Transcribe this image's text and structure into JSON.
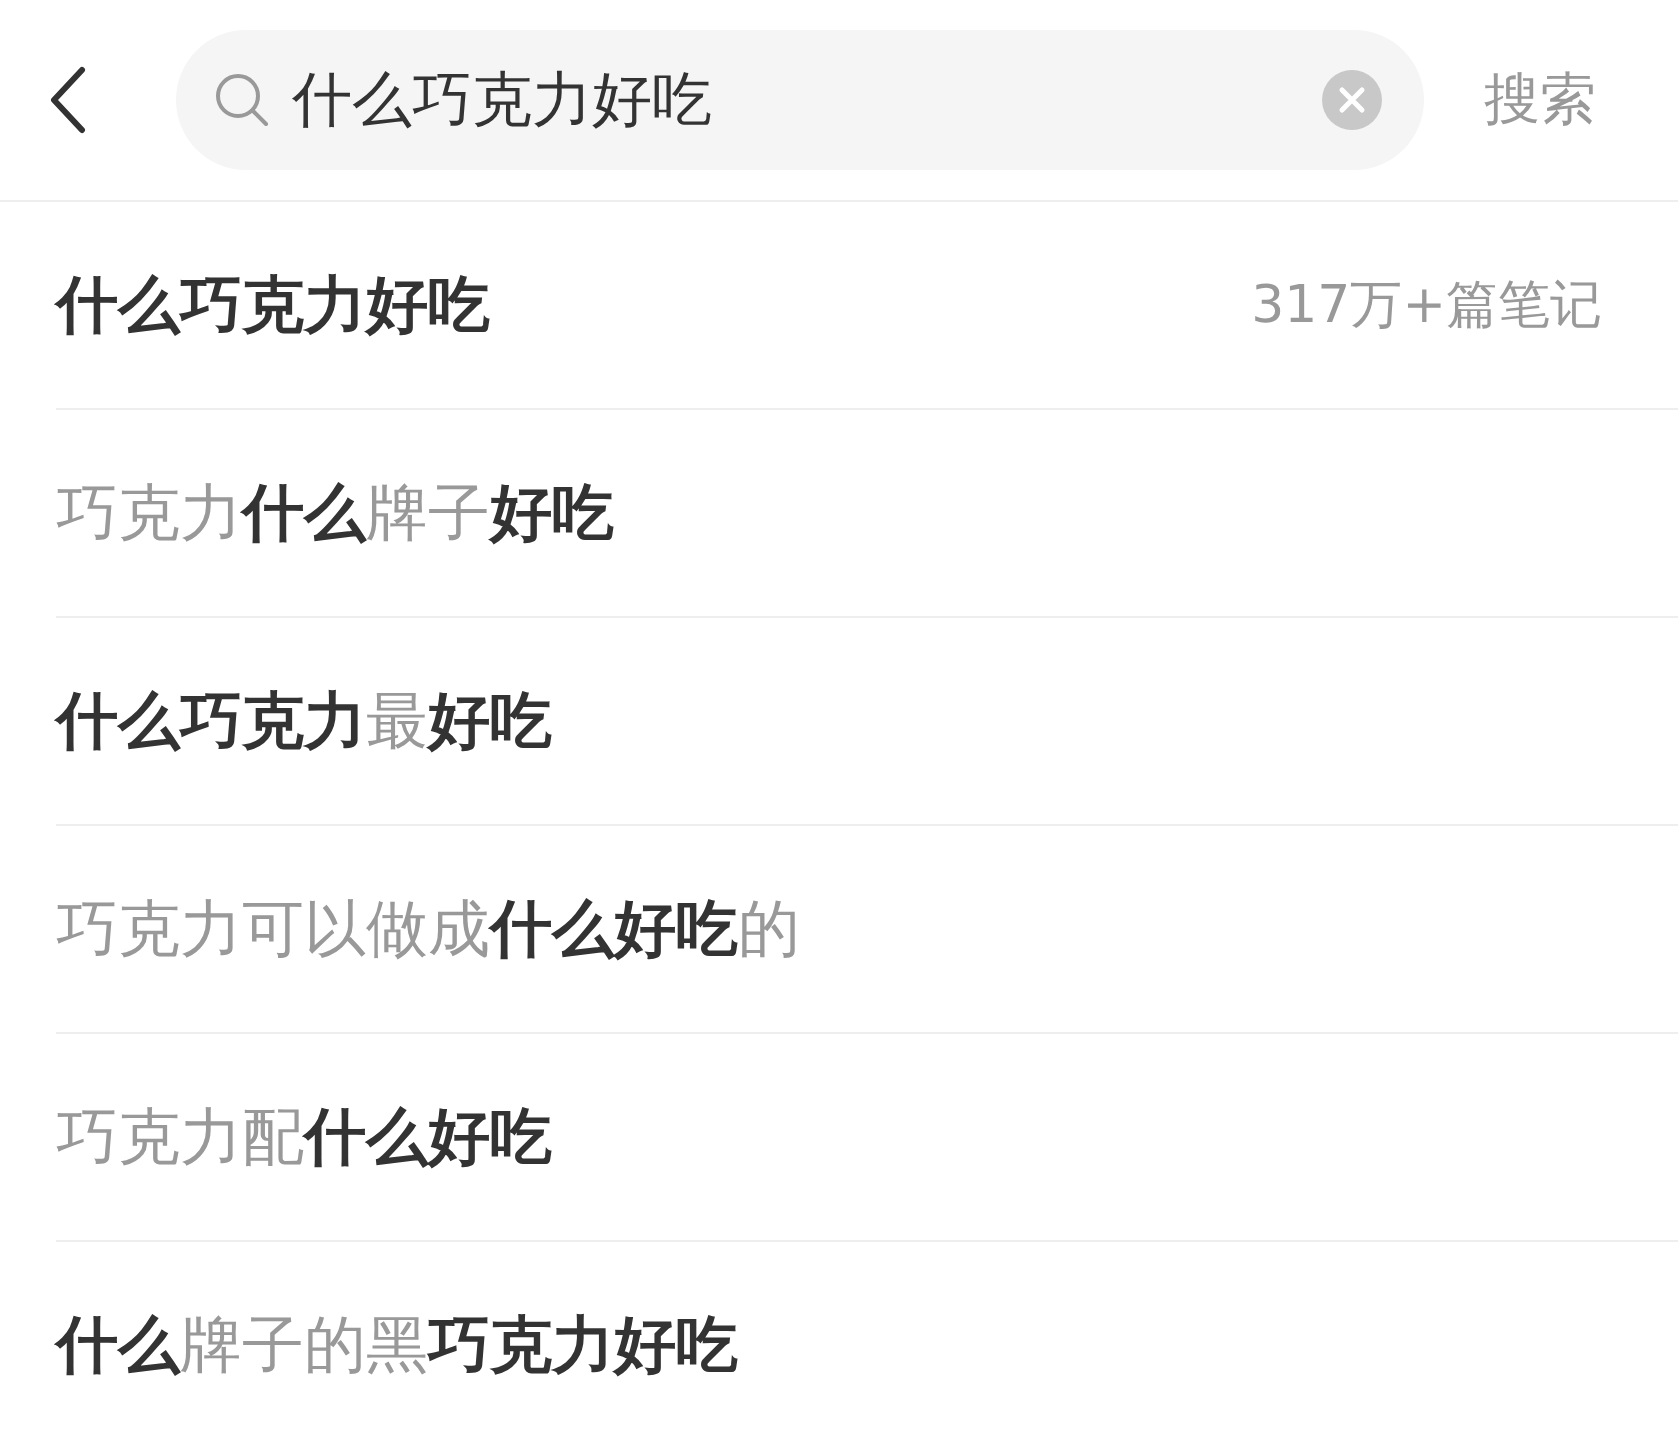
{
  "search": {
    "value": "什么巧克力好吃",
    "action": "搜索"
  },
  "suggestions": [
    {
      "segments": [
        {
          "text": "什么巧克力好吃",
          "bold": true
        }
      ],
      "count": "317万+篇笔记"
    },
    {
      "segments": [
        {
          "text": "巧克力",
          "bold": false
        },
        {
          "text": "什么",
          "bold": true
        },
        {
          "text": "牌子",
          "bold": false
        },
        {
          "text": "好吃",
          "bold": true
        }
      ]
    },
    {
      "segments": [
        {
          "text": "什么巧克力",
          "bold": true
        },
        {
          "text": "最",
          "bold": false
        },
        {
          "text": "好吃",
          "bold": true
        }
      ]
    },
    {
      "segments": [
        {
          "text": "巧克力可以做成",
          "bold": false
        },
        {
          "text": "什么好吃",
          "bold": true
        },
        {
          "text": "的",
          "bold": false
        }
      ]
    },
    {
      "segments": [
        {
          "text": "巧克力配",
          "bold": false
        },
        {
          "text": "什么好吃",
          "bold": true
        }
      ]
    },
    {
      "segments": [
        {
          "text": "什么",
          "bold": true
        },
        {
          "text": "牌子的黑",
          "bold": false
        },
        {
          "text": "巧克力好吃",
          "bold": true
        }
      ]
    }
  ]
}
